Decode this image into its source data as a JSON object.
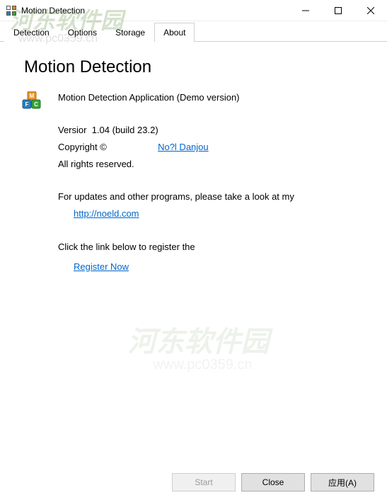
{
  "window": {
    "title": "Motion Detection"
  },
  "tabs": {
    "items": [
      "Detection",
      "Options",
      "Storage",
      "About"
    ],
    "active": 3
  },
  "about": {
    "heading": "Motion Detection",
    "app_name": "Motion Detection Application (Demo version)",
    "version_label": "Versior",
    "version_value": "1.04 (build 23.2)",
    "copyright": "Copyright ©",
    "author_link": "No?l Danjou",
    "rights": "All rights reserved.",
    "update_text": "For updates and other programs, please take a look at my",
    "site_link": "http://noeld.com",
    "register_text": "Click the link below to register the",
    "register_link": "Register Now"
  },
  "buttons": {
    "start": "Start",
    "close": "Close",
    "apply": "应用(A)"
  },
  "watermark": {
    "logo": "河东软件园",
    "url": "www.pc0359.cn"
  }
}
